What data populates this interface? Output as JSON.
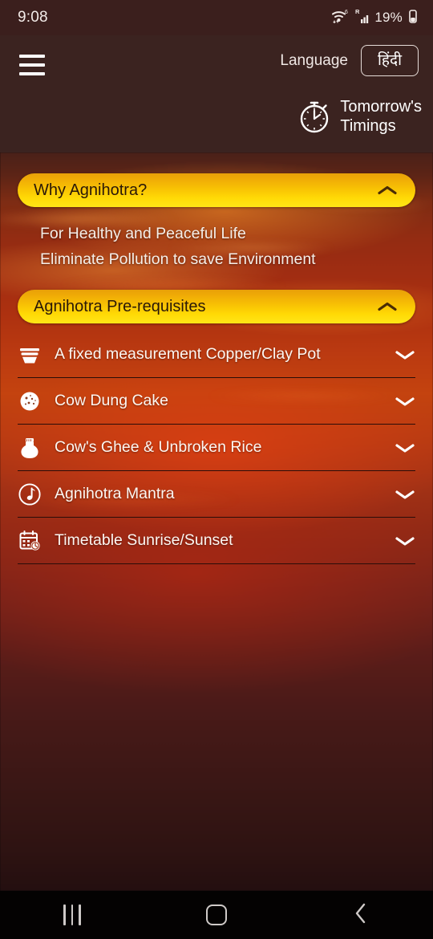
{
  "status_bar": {
    "time": "9:08",
    "battery_percent": "19%",
    "icons": [
      "wifi-6-icon",
      "roaming-signal-icon",
      "battery-icon"
    ]
  },
  "header": {
    "menu_icon": "hamburger-menu-icon",
    "language_label": "Language",
    "language_value": "हिंदी",
    "timings_icon": "stopwatch-icon",
    "timings_line1": "Tomorrow's",
    "timings_line2": "Timings"
  },
  "accordions": [
    {
      "id": "why-agnihotra",
      "title": "Why Agnihotra?",
      "expanded": true,
      "chevron": "chevron-up-icon",
      "body_lines": [
        "For Healthy and Peaceful Life",
        "Eliminate Pollution to save Environment"
      ]
    },
    {
      "id": "agnihotra-pre-requisites",
      "title": "Agnihotra Pre-requisites",
      "expanded": true,
      "chevron": "chevron-up-icon"
    }
  ],
  "prerequisites": [
    {
      "label": "A fixed measurement Copper/Clay Pot",
      "icon": "clay-pot-icon",
      "chevron": "chevron-down-icon"
    },
    {
      "label": "Cow Dung Cake",
      "icon": "cow-dung-cake-icon",
      "chevron": "chevron-down-icon"
    },
    {
      "label": "Cow's Ghee & Unbroken Rice",
      "icon": "ghee-jar-icon",
      "chevron": "chevron-down-icon"
    },
    {
      "label": "Agnihotra Mantra",
      "icon": "music-note-icon",
      "chevron": "chevron-down-icon"
    },
    {
      "label": "Timetable Sunrise/Sunset",
      "icon": "calendar-clock-icon",
      "chevron": "chevron-down-icon"
    }
  ],
  "nav_bar": {
    "recents": "recents-icon",
    "home": "home-icon",
    "back": "back-icon"
  },
  "colors": {
    "accent_gradient_top": "#e8a008",
    "accent_gradient_bottom": "#ffe617",
    "header_bg": "#3b2320",
    "status_bg": "#3b1f1d",
    "divider": "#2a0d09",
    "text_light": "#fdf7f2"
  }
}
